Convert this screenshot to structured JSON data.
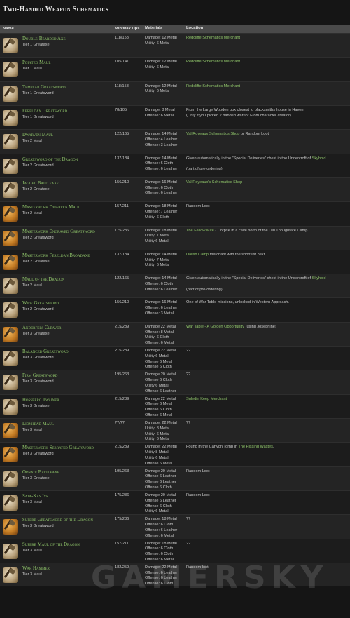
{
  "title": "Two-Handed Weapon Schematics",
  "headers": {
    "name": "Name",
    "dps": "Min/Max Dps",
    "materials": "Materials",
    "location": "Location"
  },
  "watermark": "GAMERSKY",
  "rows": [
    {
      "name": "Double-Bearded Axe",
      "tier": "Tier 1 Greataxe",
      "dps": "118/158",
      "mats": [
        "Damage: 12 Metal",
        "Utility: 6 Metal"
      ],
      "loc": [
        [
          {
            "t": "Redcliffe Schematics Merchant",
            "g": true
          }
        ]
      ],
      "icon": "pale"
    },
    {
      "name": "Pointed Maul",
      "tier": "Tier 1 Maul",
      "dps": "105/141",
      "mats": [
        "Damage: 12 Metal",
        "Utility: 6 Metal"
      ],
      "loc": [
        [
          {
            "t": "Redcliffe Schematics Merchant",
            "g": true
          }
        ]
      ],
      "icon": "pale"
    },
    {
      "name": "Templar Greatsword",
      "tier": "Tier 1 Greatsword",
      "dps": "118/158",
      "mats": [
        "Damage: 12 Metal",
        "Utility: 6 Metal"
      ],
      "loc": [
        [
          {
            "t": "Redcliffe Schematics Merchant",
            "g": true
          }
        ]
      ],
      "icon": "pale"
    },
    {
      "name": "Fereldan Greatsword",
      "tier": "Tier 1 Greatsword",
      "dps": "78/105",
      "mats": [
        "Damage: 8 Metal",
        "Offense: 6 Metal"
      ],
      "loc": [
        [
          {
            "t": "From the Large Wooden box closest to blacksmiths house in Haven",
            "g": false
          }
        ],
        [
          {
            "t": "(Only if you picked 2 handed warrior From character creator)",
            "g": false
          }
        ]
      ],
      "icon": "pale"
    },
    {
      "name": "Dwarven Maul",
      "tier": "Tier 2 Maul",
      "dps": "122/165",
      "mats": [
        "Damage: 14 Metal",
        "Offense: 4 Leather",
        "Offense: 3 Leather"
      ],
      "loc": [
        [
          {
            "t": "Val Royeaux Schematics Shop",
            "g": true
          },
          {
            "t": " or Random Loot",
            "g": false
          }
        ]
      ],
      "icon": "pale"
    },
    {
      "name": "Greatsword of the Dragon",
      "tier": "Tier 2 Greatsword",
      "dps": "137/184",
      "mats": [
        "Damage: 14 Metal",
        "Offense: 6 Cloth",
        "Offense: 6 Leather"
      ],
      "loc": [
        [
          {
            "t": "Given automatically in the \"Special Deliveries\" chest in the Undercroft of ",
            "g": false
          },
          {
            "t": "Skyhold",
            "g": true
          }
        ],
        [],
        [
          {
            "t": "(part of pre-ordering)",
            "g": false
          }
        ]
      ],
      "icon": "pale"
    },
    {
      "name": "Jagged Battleaxe",
      "tier": "Tier 2 Greataxe",
      "dps": "156/210",
      "mats": [
        "Damage: 16 Metal",
        "Offense: 6 Cloth",
        "Offense: 6 Leather"
      ],
      "loc": [
        [
          {
            "t": "Val Royeaux's Schematics Shop",
            "g": true
          }
        ]
      ],
      "icon": "pale"
    },
    {
      "name": "Masterwork Dwarven Maul",
      "tier": "Tier 2 Maul",
      "dps": "157/211",
      "mats": [
        "Damage: 18 Metal",
        "Offense: 7 Leather",
        "Utility: 6 Cloth"
      ],
      "loc": [
        [
          {
            "t": "Random Loot",
            "g": false
          }
        ]
      ],
      "icon": "orange"
    },
    {
      "name": "Masterwork Engraved Greatsword",
      "tier": "Tier 2 Greatsword",
      "dps": "175/236",
      "mats": [
        "Damage: 18 Metal",
        "Utility: 7 Metal",
        "Utility 6 Metal"
      ],
      "loc": [
        [
          {
            "t": "The Fallow Mire",
            "g": true
          },
          {
            "t": " - Corpse in a cave north of the Old Thoughfare Camp",
            "g": false
          }
        ]
      ],
      "icon": "orange"
    },
    {
      "name": "Masterwork Fereldan Broadaxe",
      "tier": "Tier 2 Greataxe",
      "dps": "137/184",
      "mats": [
        "Damage: 14 Metal",
        "Utility: 7 Metal",
        "Utility: 6 Metal"
      ],
      "loc": [
        [
          {
            "t": "Dalish Camp",
            "g": true
          },
          {
            "t": " merchant with the short list pekr",
            "g": false
          }
        ]
      ],
      "icon": "orange"
    },
    {
      "name": "Maul of the Dragon",
      "tier": "Tier 2 Maul",
      "dps": "122/165",
      "mats": [
        "Damage: 14 Metal",
        "Offense: 6 Cloth",
        "Offense: 6 Leather"
      ],
      "loc": [
        [
          {
            "t": "Given automatically in the \"Special Deliveries\" chest in the Undercroft of ",
            "g": false
          },
          {
            "t": "Skyhold",
            "g": true
          }
        ],
        [],
        [
          {
            "t": "(part of pre-ordering)",
            "g": false
          }
        ]
      ],
      "icon": "pale"
    },
    {
      "name": "Wide Greatsword",
      "tier": "Tier 2 Greatsword",
      "dps": "156/210",
      "mats": [
        "Damage: 16 Metal",
        "Offense: 6 Leather",
        "Offense: 3 Metal"
      ],
      "loc": [
        [
          {
            "t": "One of War Table missions, unlocked in Western Approach.",
            "g": false
          }
        ]
      ],
      "icon": "pale"
    },
    {
      "name": "Anderfels Cleaver",
      "tier": "Tier 3 Greataxe",
      "dps": "215/289",
      "mats": [
        "Damage 22 Metal",
        "Offense: 8 Metal",
        "Utility: 6 Cloth",
        "Offense: 6 Metal"
      ],
      "loc": [
        [
          {
            "t": "War Table - A Golden Opportunity",
            "g": true
          },
          {
            "t": " (using Josephine)",
            "g": false
          }
        ]
      ],
      "icon": "orange"
    },
    {
      "name": "Balanced Greatsword",
      "tier": "Tier 3 Greatsword",
      "dps": "215/289",
      "mats": [
        "Damage 22 Metal",
        "Utility 6 Metal",
        "Offense 6 Metal",
        "Offense 6 Cloth"
      ],
      "loc": [
        [
          {
            "t": "??",
            "g": false
          }
        ]
      ],
      "icon": "pale"
    },
    {
      "name": "Firm Greatsword",
      "tier": "Tier 3 Greatsword",
      "dps": "195/263",
      "mats": [
        "Damage 20 Metal",
        "Offense 6 Cloth",
        "Utility 6 Metal",
        "Offense 6 Leather"
      ],
      "loc": [
        [
          {
            "t": "??",
            "g": false
          }
        ]
      ],
      "icon": "pale"
    },
    {
      "name": "Hossberg Twainer",
      "tier": "Tier 3 Greataxe",
      "dps": "215/289",
      "mats": [
        "Damage 22 Metal",
        "Offense 6 Metal",
        "Offense 6 Cloth",
        "Offense 6 Metal"
      ],
      "loc": [
        [
          {
            "t": "Suledin Keep Merchant",
            "g": true
          }
        ]
      ],
      "icon": "pale"
    },
    {
      "name": "Lionhead Maul",
      "tier": "Tier 3 Maul",
      "dps": "??/??",
      "mats": [
        "Damage: 22 Metal",
        "Utility: 8 Metal",
        "Utility: 6 Metal",
        "Utility: 6 Metal"
      ],
      "loc": [
        [
          {
            "t": "??",
            "g": false
          }
        ]
      ],
      "icon": "orange"
    },
    {
      "name": "Masterwork Serrated Greatsword",
      "tier": "Tier 3 Greatsword",
      "dps": "215/289",
      "mats": [
        "Damage: 22 Metal",
        "Utility 8 Metal",
        "Utility 6 Metal",
        "Offense 6 Metal"
      ],
      "loc": [
        [
          {
            "t": "Found in the Canyon Tomb in ",
            "g": false
          },
          {
            "t": "The Hissing Wastes",
            "g": true
          },
          {
            "t": ".",
            "g": false
          }
        ]
      ],
      "icon": "orange"
    },
    {
      "name": "Ornate Battleaxe",
      "tier": "Tier 3 Greataxe",
      "dps": "195/263",
      "mats": [
        "Damage 20 Metal",
        "Offense 6 Leather",
        "Offense 6 Leather",
        "Offense 6 Cloth"
      ],
      "loc": [
        [
          {
            "t": "Random Loot",
            "g": false
          }
        ]
      ],
      "icon": "pale"
    },
    {
      "name": "Sata-Kas Iss",
      "tier": "Tier 3 Maul",
      "dps": "175/236",
      "mats": [
        "Damage 20 Metal",
        "Offense 6 Leather",
        "Offense 6 Cloth",
        "Utility 6 Metal"
      ],
      "loc": [
        [
          {
            "t": "Random Loot",
            "g": false
          }
        ]
      ],
      "icon": "pale"
    },
    {
      "name": "Superb Greatsword of the Dragon",
      "tier": "Tier 3 Greatsword",
      "dps": "175/236",
      "mats": [
        "Damage: 18 Metal",
        "Offense: 6 Cloth",
        "Offense: 6 Leather",
        "Offense: 6 Metal"
      ],
      "loc": [
        [
          {
            "t": "??",
            "g": false
          }
        ]
      ],
      "icon": "orange"
    },
    {
      "name": "Superb Maul of the Dragon",
      "tier": "Tier 3 Maul",
      "dps": "157/211",
      "mats": [
        "Damage: 18 Metal",
        "Offense: 6 Cloth",
        "Offense: 6 Cloth",
        "Offense: 6 Metal"
      ],
      "loc": [
        [
          {
            "t": "??",
            "g": false
          }
        ]
      ],
      "icon": "pale"
    },
    {
      "name": "War Hammer",
      "tier": "Tier 3 Maul",
      "dps": "182/259",
      "mats": [
        "Damage: 22 Metal",
        "Offense: 6 Leather",
        "Offense: 6 Leather",
        "Offense: 6 Cloth"
      ],
      "loc": [
        [
          {
            "t": "Random loot",
            "g": false
          }
        ]
      ],
      "icon": "pale"
    }
  ]
}
